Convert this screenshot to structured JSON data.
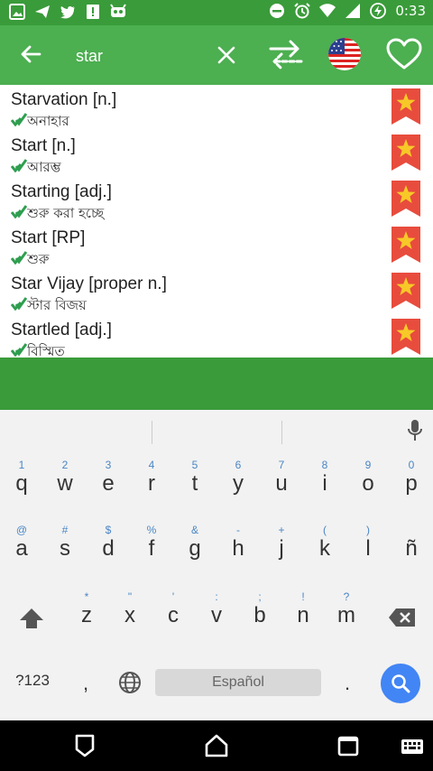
{
  "status": {
    "time": "0:33"
  },
  "search": {
    "value": "star"
  },
  "results": [
    {
      "term": "Starvation [n.]",
      "translation": "অনাহার"
    },
    {
      "term": "Start [n.]",
      "translation": "আরম্ভ"
    },
    {
      "term": "Starting [adj.]",
      "translation": "শুরু করা হচ্ছে"
    },
    {
      "term": "Start [RP]",
      "translation": "শুরু"
    },
    {
      "term": "Star Vijay [proper n.]",
      "translation": "স্টার বিজয়"
    },
    {
      "term": "Startled [adj.]",
      "translation": "বিস্মিত"
    }
  ],
  "keyboard": {
    "row1": [
      {
        "k": "q",
        "h": "1"
      },
      {
        "k": "w",
        "h": "2"
      },
      {
        "k": "e",
        "h": "3"
      },
      {
        "k": "r",
        "h": "4"
      },
      {
        "k": "t",
        "h": "5"
      },
      {
        "k": "y",
        "h": "6"
      },
      {
        "k": "u",
        "h": "7"
      },
      {
        "k": "i",
        "h": "8"
      },
      {
        "k": "o",
        "h": "9"
      },
      {
        "k": "p",
        "h": "0"
      }
    ],
    "row2": [
      {
        "k": "a",
        "h": "@"
      },
      {
        "k": "s",
        "h": "#"
      },
      {
        "k": "d",
        "h": "$"
      },
      {
        "k": "f",
        "h": "%"
      },
      {
        "k": "g",
        "h": "&"
      },
      {
        "k": "h",
        "h": "-"
      },
      {
        "k": "j",
        "h": "+"
      },
      {
        "k": "k",
        "h": "("
      },
      {
        "k": "l",
        "h": ")"
      },
      {
        "k": "ñ",
        "h": ""
      }
    ],
    "row3": [
      {
        "k": "z",
        "h": "*"
      },
      {
        "k": "x",
        "h": "\""
      },
      {
        "k": "c",
        "h": "'"
      },
      {
        "k": "v",
        "h": ":"
      },
      {
        "k": "b",
        "h": ";"
      },
      {
        "k": "n",
        "h": "!"
      },
      {
        "k": "m",
        "h": "?"
      }
    ],
    "symbols_label": "?123",
    "comma": ",",
    "period": ".",
    "space_label": "Español"
  },
  "colors": {
    "toolbar": "#4caf50",
    "status": "#3a9b3a",
    "fav": "#e84c3d",
    "star": "#f7c928",
    "check": "#2e9e4f",
    "enter": "#4285f4"
  },
  "icons": {
    "back": "arrow-left-icon",
    "clear": "close-icon",
    "swap": "swap-languages-icon",
    "flag": "us-flag-icon",
    "heart": "heart-outline-icon",
    "fav": "favorite-bookmark-star-icon",
    "verified": "verified-check-icon",
    "mic": "microphone-icon",
    "shift": "shift-icon",
    "backspace": "backspace-icon",
    "globe": "globe-icon",
    "search": "search-icon"
  }
}
